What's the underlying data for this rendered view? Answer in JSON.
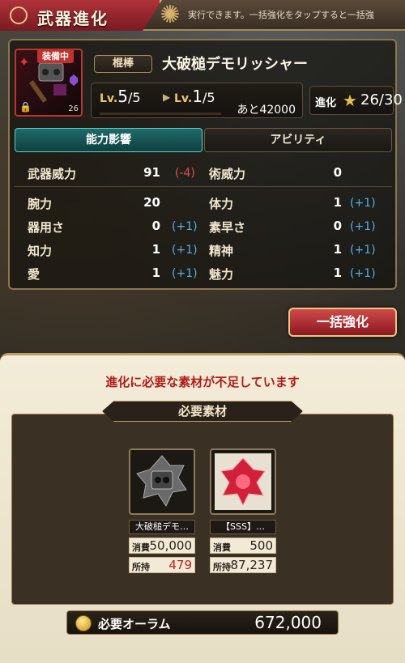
{
  "header": {
    "title": "武器進化",
    "ticker": "実行できます。一括強化をタップすると一括強"
  },
  "weapon": {
    "equip_badge": "装備中",
    "icon_level": "26",
    "type": "棍棒",
    "name": "大破槌デモリッシャー",
    "lv_label": "Lv.",
    "lv_current": "5",
    "lv_current_max": "/5",
    "lv_next": "1",
    "lv_next_max": "/5",
    "exp_remaining": "あと42000",
    "evo_label": "進化",
    "evo_value": "26/30"
  },
  "tabs": {
    "active": "能力影響",
    "inactive": "アビリティ"
  },
  "stats": {
    "weapon_power": {
      "label": "武器威力",
      "value": "91",
      "diff": "(-4)"
    },
    "skill_power": {
      "label": "術威力",
      "value": "0"
    },
    "rows": [
      {
        "l_label": "腕力",
        "l_val": "20",
        "l_diff": "",
        "r_label": "体力",
        "r_val": "1",
        "r_diff": "(+1)"
      },
      {
        "l_label": "器用さ",
        "l_val": "0",
        "l_diff": "(+1)",
        "r_label": "素早さ",
        "r_val": "0",
        "r_diff": "(+1)"
      },
      {
        "l_label": "知力",
        "l_val": "1",
        "l_diff": "(+1)",
        "r_label": "精神",
        "r_val": "1",
        "r_diff": "(+1)"
      },
      {
        "l_label": "愛",
        "l_val": "1",
        "l_diff": "(+1)",
        "r_label": "魅力",
        "r_val": "1",
        "r_diff": "(+1)"
      }
    ]
  },
  "bulk_button": "一括強化",
  "lower": {
    "warning": "進化に必要な素材が不足しています",
    "required_label": "必要素材",
    "materials": [
      {
        "name": "大破槌デモ…",
        "consume_label": "消費",
        "consume": "50,000",
        "own_label": "所持",
        "own": "479"
      },
      {
        "name": "【SSS】…",
        "consume_label": "消費",
        "consume": "500",
        "own_label": "所持",
        "own": "87,237"
      }
    ],
    "aurum_label": "必要オーラム",
    "aurum_value": "672,000"
  },
  "colors": {
    "accent_red": "#b01c18",
    "tab_active": "#1f6a6a",
    "diff_positive": "#4fb0e8",
    "diff_negative": "#e05050"
  }
}
